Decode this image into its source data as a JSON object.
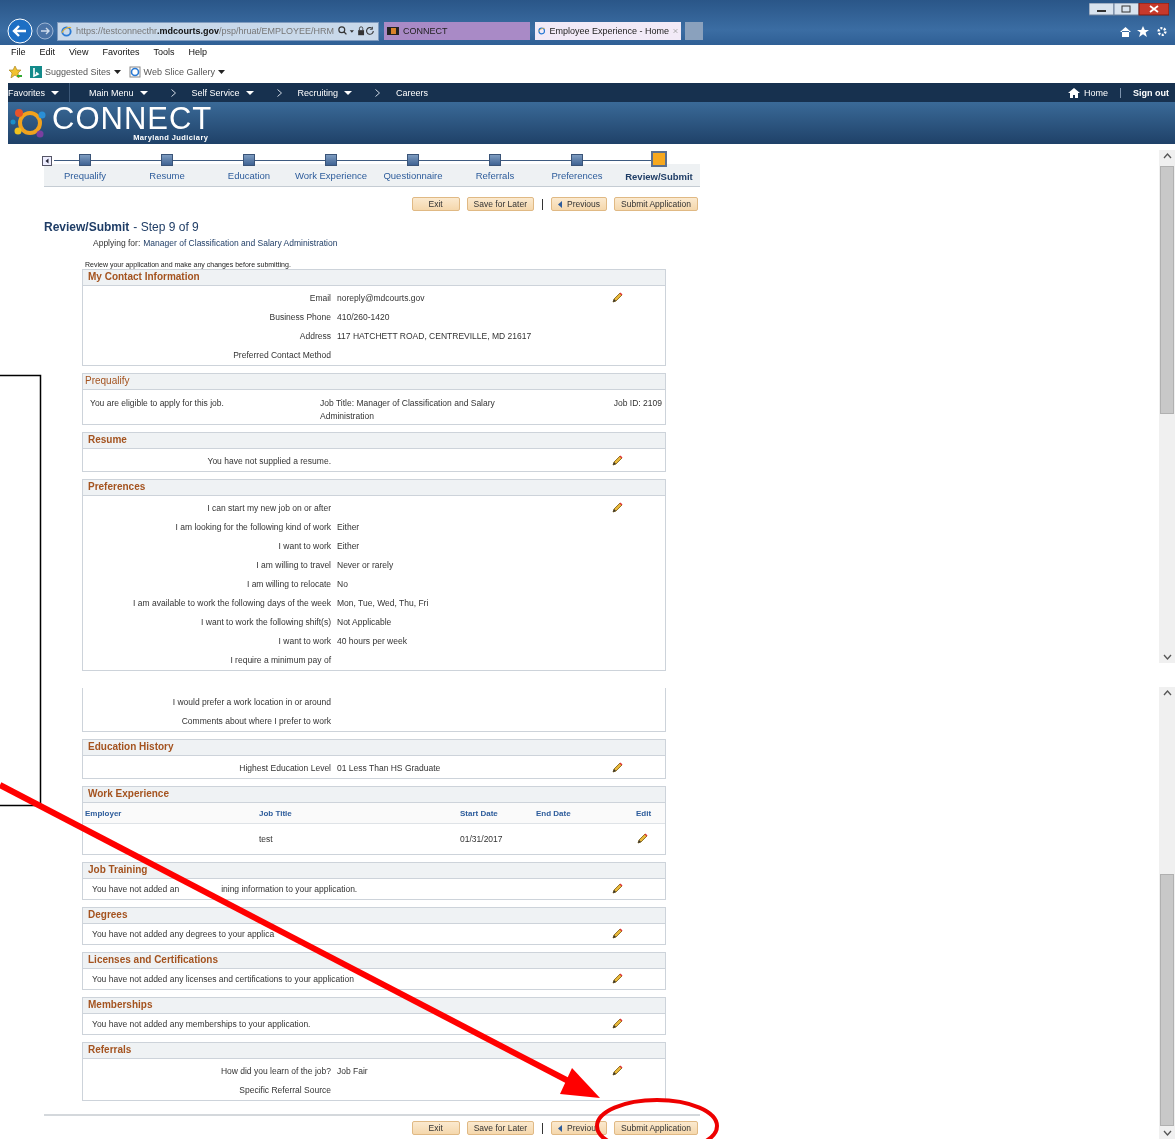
{
  "browser": {
    "address": "https://testconnecthr**.mdcourts.gov**/psp/hruat/EMPLOYEE/HRM",
    "tabs": [
      {
        "label": "CONNECT",
        "selected": false
      },
      {
        "label": "Employee Experience - Home",
        "selected": true
      }
    ],
    "menu": [
      "File",
      "Edit",
      "View",
      "Favorites",
      "Tools",
      "Help"
    ],
    "favorites_bar": [
      "Suggested Sites",
      "Web Slice Gallery"
    ]
  },
  "nav": {
    "items": [
      {
        "label": "Favorites",
        "dropdown": true,
        "crumb": false
      },
      {
        "label": "Main Menu",
        "dropdown": true,
        "crumb": false
      },
      {
        "label": "Self Service",
        "dropdown": true,
        "crumb": true
      },
      {
        "label": "Recruiting",
        "dropdown": true,
        "crumb": true
      },
      {
        "label": "Careers",
        "dropdown": false,
        "crumb": true
      }
    ],
    "home": "Home",
    "sign_out": "Sign out"
  },
  "banner": {
    "logo": "CONNECT",
    "tagline": "Maryland Judiciary"
  },
  "steps": [
    {
      "label": "Prequalify",
      "selected": false
    },
    {
      "label": "Resume",
      "selected": false
    },
    {
      "label": "Education",
      "selected": false
    },
    {
      "label": "Work Experience",
      "selected": false
    },
    {
      "label": "Questionnaire",
      "selected": false
    },
    {
      "label": "Referrals",
      "selected": false
    },
    {
      "label": "Preferences",
      "selected": false
    },
    {
      "label": "Review/Submit",
      "selected": true
    }
  ],
  "top_buttons": [
    {
      "label": "Exit",
      "kind": "plain"
    },
    {
      "label": "Save for Later",
      "kind": "plain"
    },
    {
      "label": "Previous",
      "kind": "back"
    },
    {
      "label": "Submit Application",
      "kind": "plain"
    }
  ],
  "heading": {
    "title": "Review/Submit",
    "step": "- Step 9 of 9",
    "applying_label": "Applying for:",
    "applying_value": "Manager of Classification and Salary Administration",
    "instructions": "Review your application and make any changes before submitting."
  },
  "sections": [
    {
      "title": "My Contact Information",
      "kind": "fields",
      "editable": true,
      "fields": [
        {
          "label": "Email",
          "value": "noreply@mdcourts.gov"
        },
        {
          "label": "Business Phone",
          "value": "410/260-1420"
        },
        {
          "label": "Address",
          "value": "117 HATCHETT ROAD, CENTREVILLE, MD 21617"
        },
        {
          "label": "Preferred Contact Method"
        }
      ]
    },
    {
      "title": "Prequalify",
      "kind": "prequalify",
      "eligibility": "You are eligible to apply for this job.",
      "job_title": "Job Title: Manager of Classification and Salary Administration",
      "job_id": "Job ID: 2109"
    },
    {
      "title": "Resume",
      "kind": "fields",
      "editable": true,
      "fields": [
        {
          "label": "You have not supplied a resume."
        }
      ]
    },
    {
      "title": "Preferences",
      "kind": "fields",
      "editable": true,
      "fields": [
        {
          "label": "I can start my new job on or after"
        },
        {
          "label": "I am looking for the following kind of work",
          "value": "Either"
        },
        {
          "label": "I want to work",
          "value": "Either"
        },
        {
          "label": "I am willing to travel",
          "value": "Never or rarely"
        },
        {
          "label": "I am willing to relocate",
          "value": "No"
        },
        {
          "label": "I am available to work the following days of the week",
          "value": "Mon, Tue, Wed, Thu, Fri"
        },
        {
          "label": "I want to work the following shift(s)",
          "value": "Not Applicable"
        },
        {
          "label": "I want to work",
          "value": "40 hours per week"
        },
        {
          "label": "I require a minimum pay of"
        }
      ],
      "continued_fields": [
        {
          "label": "I would prefer a work location in or around"
        },
        {
          "label": "Comments about where I prefer to work"
        }
      ]
    },
    {
      "title": "Education History",
      "kind": "fields",
      "editable": true,
      "fields": [
        {
          "label": "Highest Education Level",
          "value": "01 Less Than HS Graduate"
        }
      ]
    },
    {
      "title": "Work Experience",
      "kind": "table",
      "columns": [
        "Employer",
        "Job Title",
        "Start Date",
        "End Date",
        "Edit"
      ],
      "rows": [
        {
          "cells": [
            "",
            "test",
            "01/31/2017",
            ""
          ],
          "editable": true
        }
      ]
    },
    {
      "title": "Job Training",
      "kind": "message",
      "editable": true,
      "text": [
        "You have not added an",
        "ining information to your application."
      ]
    },
    {
      "title": "Degrees",
      "kind": "message",
      "editable": true,
      "text": [
        "You have not added any degrees to your applica"
      ]
    },
    {
      "title": "Licenses and Certifications",
      "kind": "message",
      "editable": true,
      "text": [
        "You have not added any licenses and certifications to your application"
      ]
    },
    {
      "title": "Memberships",
      "kind": "message",
      "editable": true,
      "text": [
        "You have not added any memberships to your application."
      ]
    },
    {
      "title": "Referrals",
      "kind": "fields",
      "editable": true,
      "fields": [
        {
          "label": "How did you learn of the job?",
          "value": "Job Fair"
        },
        {
          "label": "Specific Referral Source"
        }
      ]
    }
  ],
  "bottom_buttons": [
    {
      "label": "Exit",
      "kind": "plain"
    },
    {
      "label": "Save for Later",
      "kind": "plain"
    },
    {
      "label": "Previou",
      "kind": "back"
    },
    {
      "label": "Submit Application",
      "kind": "plain"
    }
  ],
  "annotations": [
    {
      "kind": "frame"
    },
    {
      "kind": "arrow"
    },
    {
      "kind": "ellipse"
    }
  ]
}
